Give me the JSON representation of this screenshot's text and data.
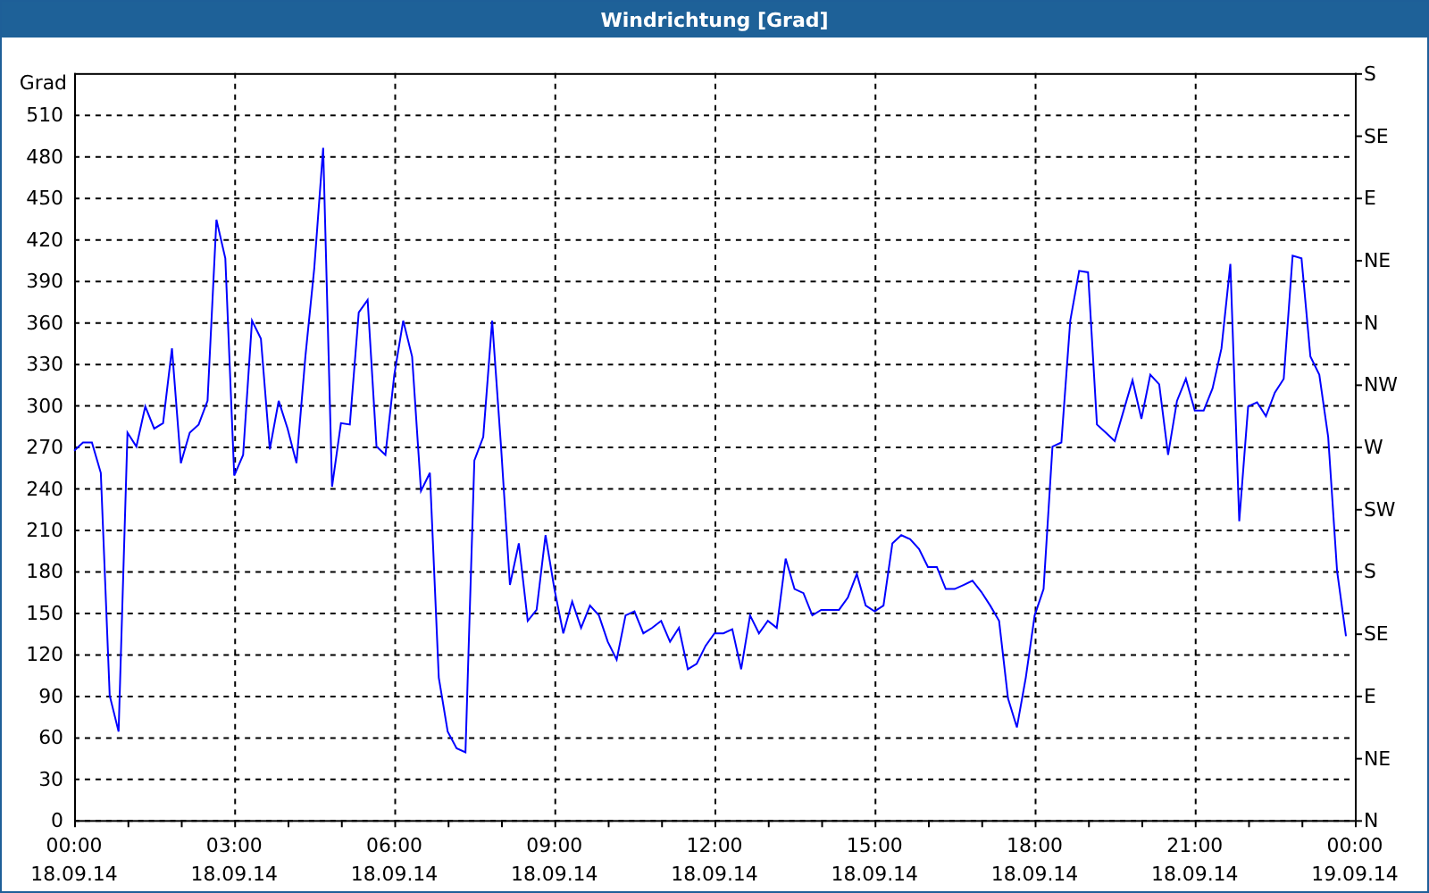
{
  "window": {
    "title": "Windrichtung [Grad]"
  },
  "chart": {
    "chart_data": {
      "type": "line",
      "grid": true,
      "ylabel": "Grad",
      "ylim": [
        0,
        540
      ],
      "yticks": [
        0,
        30,
        60,
        90,
        120,
        150,
        180,
        210,
        240,
        270,
        300,
        330,
        360,
        390,
        420,
        450,
        480,
        510
      ],
      "categories": [
        "00:00 18.09.14",
        null,
        null,
        null,
        null,
        null,
        null,
        null,
        null,
        null,
        null,
        null,
        null,
        null,
        null,
        null,
        null,
        null,
        "03:00 18.09.14",
        null,
        null,
        null,
        null,
        null,
        null,
        null,
        null,
        null,
        null,
        null,
        null,
        null,
        null,
        null,
        null,
        null,
        "06:00 18.09.14",
        null,
        null,
        null,
        null,
        null,
        null,
        null,
        null,
        null,
        null,
        null,
        null,
        null,
        null,
        null,
        null,
        null,
        "09:00 18.09.14",
        null,
        null,
        null,
        null,
        null,
        null,
        null,
        null,
        null,
        null,
        null,
        null,
        null,
        null,
        null,
        null,
        null,
        "12:00 18.09.14",
        null,
        null,
        null,
        null,
        null,
        null,
        null,
        null,
        null,
        null,
        null,
        null,
        null,
        null,
        null,
        null,
        null,
        "15:00 18.09.14",
        null,
        null,
        null,
        null,
        null,
        null,
        null,
        null,
        null,
        null,
        null,
        null,
        null,
        null,
        null,
        null,
        null,
        "18:00 18.09.14",
        null,
        null,
        null,
        null,
        null,
        null,
        null,
        null,
        null,
        null,
        null,
        null,
        null,
        null,
        null,
        null,
        null,
        "21:00 18.09.14",
        null,
        null,
        null,
        null,
        null,
        null,
        null,
        null,
        null,
        null,
        null,
        null,
        null,
        null,
        null,
        null,
        null,
        "00:00 19.09.14"
      ],
      "series": [
        {
          "color": "#0000ff",
          "values": [
            267,
            273,
            273,
            251,
            90,
            64,
            280,
            270,
            299,
            283,
            287,
            341,
            258,
            280,
            286,
            303,
            434,
            406,
            249,
            264,
            361,
            348,
            268,
            303,
            283,
            258,
            335,
            399,
            486,
            241,
            287,
            286,
            367,
            376,
            270,
            264,
            322,
            361,
            335,
            238,
            251,
            103,
            64,
            52,
            49,
            260,
            277,
            361,
            270,
            170,
            200,
            144,
            152,
            206,
            167,
            135,
            158,
            139,
            155,
            148,
            129,
            116,
            148,
            151,
            135,
            139,
            144,
            129,
            139,
            109,
            113,
            126,
            135,
            135,
            138,
            109,
            148,
            135,
            144,
            139,
            189,
            167,
            164,
            148,
            152,
            152,
            152,
            161,
            178,
            155,
            151,
            155,
            200,
            206,
            203,
            196,
            183,
            183,
            167,
            167,
            170,
            173,
            165,
            155,
            144,
            88,
            67,
            103,
            148,
            167,
            270,
            273,
            361,
            397,
            396,
            286,
            280,
            274,
            296,
            318,
            290,
            322,
            315,
            264,
            303,
            319,
            296,
            296,
            312,
            341,
            402,
            216,
            299,
            302,
            292,
            309,
            319,
            408,
            406,
            335,
            322,
            277,
            180,
            133,
            null
          ]
        }
      ]
    },
    "right_axis": [
      "S",
      "SE",
      "E",
      "NE",
      "N",
      "NW",
      "W",
      "SW",
      "S",
      "SE",
      "E",
      "NE",
      "N"
    ]
  }
}
